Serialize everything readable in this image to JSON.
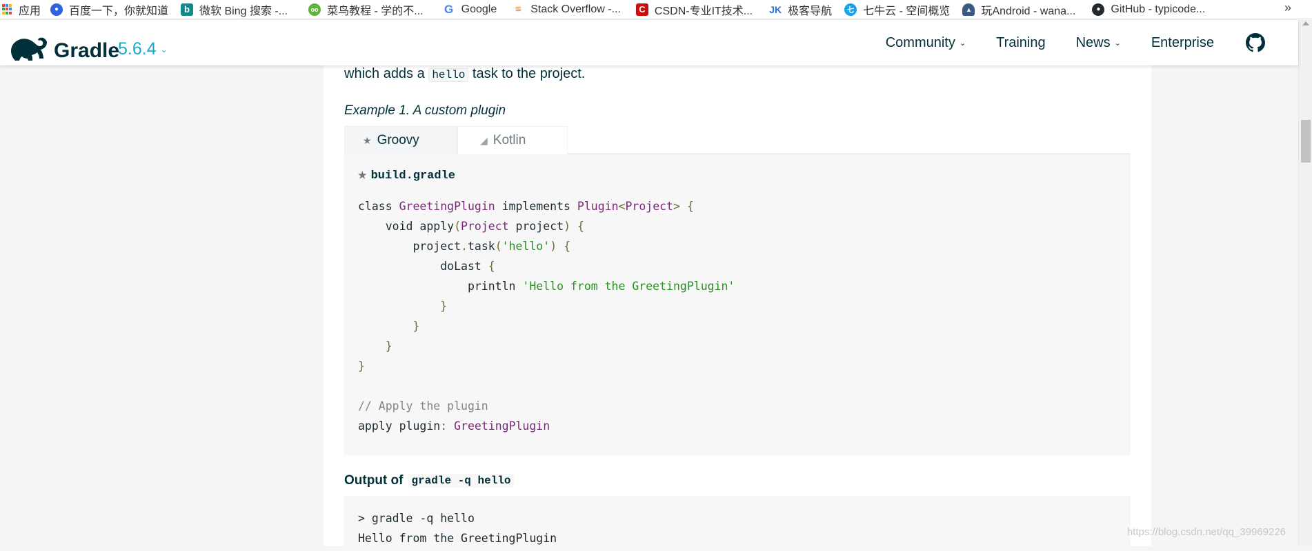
{
  "bookmarks": {
    "items": [
      {
        "label": "应用",
        "icon": "apps-grid-icon",
        "color": "#e8453c"
      },
      {
        "label": "百度一下，你就知道",
        "icon": "baidu-paw-icon",
        "color": "#2e62e0"
      },
      {
        "label": "微软 Bing 搜索 -...",
        "icon": "bing-icon",
        "color": "#138a8a"
      },
      {
        "label": "菜鸟教程 - 学的不...",
        "icon": "runoob-icon",
        "color": "#5fb336"
      },
      {
        "label": "Google",
        "icon": "google-icon",
        "color": "#4285f4"
      },
      {
        "label": "Stack Overflow -...",
        "icon": "stackoverflow-icon",
        "color": "#f48024"
      },
      {
        "label": "CSDN-专业IT技术...",
        "icon": "csdn-icon",
        "color": "#c90e0e"
      },
      {
        "label": "极客导航",
        "icon": "jike-icon",
        "color": "#2a6fd6"
      },
      {
        "label": "七牛云 - 空间概览",
        "icon": "qiniu-icon",
        "color": "#1aa1e8"
      },
      {
        "label": "玩Android - wana...",
        "icon": "android-icon",
        "color": "#3b5a82"
      },
      {
        "label": "GitHub - typicode...",
        "icon": "github-icon",
        "color": "#24292e"
      }
    ],
    "more": "»"
  },
  "header": {
    "brand": "Gradle",
    "version": "5.6.4",
    "nav": [
      {
        "label": "Community",
        "dropdown": true
      },
      {
        "label": "Training",
        "dropdown": false
      },
      {
        "label": "News",
        "dropdown": true
      },
      {
        "label": "Enterprise",
        "dropdown": false
      }
    ]
  },
  "content": {
    "intro_before": "which adds a",
    "intro_code": "hello",
    "intro_after": "task to the project.",
    "example_title": "Example 1. A custom plugin",
    "tabs": [
      {
        "label": "Groovy",
        "icon": "groovy-star-icon",
        "active": true
      },
      {
        "label": "Kotlin",
        "icon": "kotlin-icon",
        "active": false
      }
    ],
    "file_title": "build.gradle",
    "output_label": "Output of",
    "output_code": "gradle -q hello",
    "output_lines": [
      "> gradle -q hello",
      "Hello from the GreetingPlugin"
    ]
  },
  "watermark": "https://blog.csdn.net/qq_39969226"
}
